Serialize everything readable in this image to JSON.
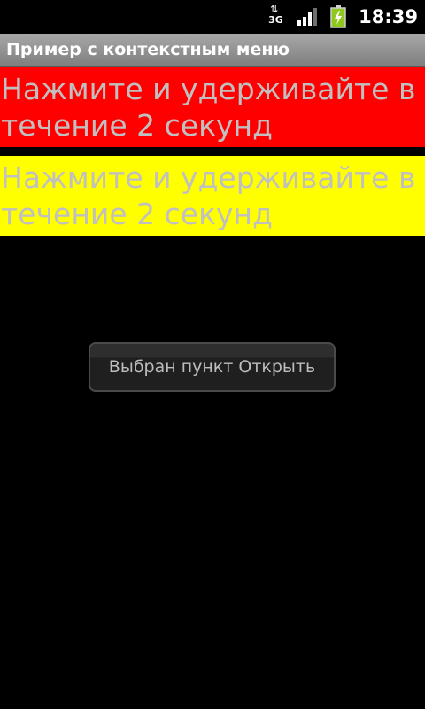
{
  "status_bar": {
    "network_type": "3G",
    "time": "18:39",
    "icons": [
      "data-arrows-icon",
      "signal-strength-icon",
      "battery-charging-icon"
    ]
  },
  "app": {
    "title": "Пример с контекстным меню"
  },
  "blocks": [
    {
      "text": "Нажмите и удерживайте в течение 2 секунд",
      "background": "#ff0000"
    },
    {
      "text": "Нажмите и удерживайте в течение 2 секунд",
      "background": "#ffff00"
    }
  ],
  "toast": {
    "message": "Выбран пункт Открыть"
  },
  "colors": {
    "background": "#000000",
    "text_gray": "#c0c0c0",
    "title_bar": "#909090"
  }
}
